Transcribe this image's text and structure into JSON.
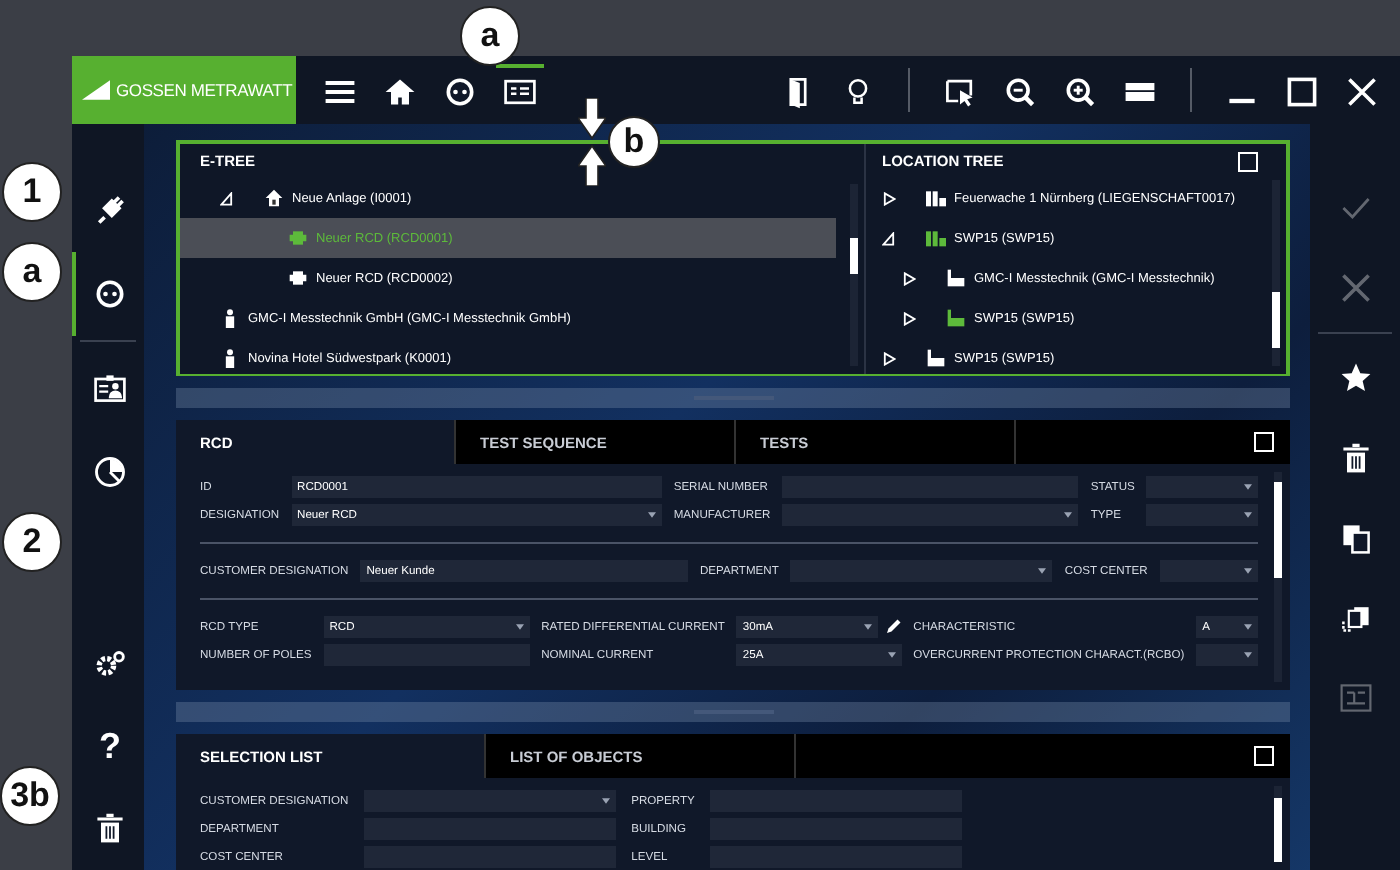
{
  "callouts": [
    {
      "label": "a",
      "kind": "circle"
    },
    {
      "label": "1",
      "kind": "circle"
    },
    {
      "label": "a",
      "kind": "circle"
    },
    {
      "label": "2",
      "kind": "circle"
    },
    {
      "label": "3b",
      "kind": "circle"
    },
    {
      "label": "b",
      "kind": "gap_marker"
    }
  ],
  "logo": {
    "text": "GOSSEN METRAWATT"
  },
  "toolbar_left": [
    {
      "kind": "menu",
      "selected": false
    },
    {
      "kind": "home",
      "selected": false
    },
    {
      "kind": "socket",
      "selected": false
    },
    {
      "kind": "panel",
      "selected": true
    }
  ],
  "toolbar_right": [
    {
      "kind": "door"
    },
    {
      "kind": "bulb"
    },
    {
      "kind": "separator"
    },
    {
      "kind": "select"
    },
    {
      "kind": "zoom-out"
    },
    {
      "kind": "zoom-in"
    },
    {
      "kind": "layout"
    },
    {
      "kind": "separator"
    },
    {
      "kind": "minimize"
    },
    {
      "kind": "maximize"
    },
    {
      "kind": "close"
    }
  ],
  "left_sidebar": {
    "top": [
      {
        "kind": "plug",
        "selected": false
      },
      {
        "kind": "socket",
        "selected": true
      },
      {
        "kind": "id-card",
        "selected": false
      },
      {
        "kind": "pie",
        "selected": false
      }
    ],
    "bottom": [
      {
        "kind": "gear",
        "selected": false
      },
      {
        "kind": "help",
        "glyph": "?",
        "selected": false
      },
      {
        "kind": "trash",
        "selected": false
      }
    ]
  },
  "right_sidebar": [
    {
      "kind": "check",
      "disabled": true
    },
    {
      "kind": "close",
      "disabled": true
    },
    {
      "kind": "star",
      "disabled": false
    },
    {
      "kind": "trash",
      "disabled": false
    },
    {
      "kind": "copy",
      "disabled": false
    },
    {
      "kind": "copy-move",
      "disabled": false
    },
    {
      "kind": "diagram",
      "disabled": true
    }
  ],
  "e_tree": {
    "title": "E-TREE",
    "items": [
      {
        "label": "Neue Anlage (I0001)",
        "kind": "house",
        "expanded": true,
        "selected": false,
        "children": [
          {
            "label": "Neuer RCD (RCD0001)",
            "kind": "rcd",
            "selected": true
          },
          {
            "label": "Neuer RCD (RCD0002)",
            "kind": "rcd",
            "selected": false
          }
        ]
      },
      {
        "label": "GMC-I Messtechnik GmbH (GMC-I Messtechnik GmbH)",
        "kind": "person",
        "selected": false
      },
      {
        "label": "Novina Hotel Südwestpark (K0001)",
        "kind": "person",
        "selected": false
      }
    ]
  },
  "location_tree": {
    "title": "LOCATION TREE",
    "items": [
      {
        "label": "Feuerwache 1 Nürnberg (LIEGENSCHAFT0017)",
        "kind": "property",
        "expanded": false,
        "highlighted": false
      },
      {
        "label": "SWP15 (SWP15)",
        "kind": "property",
        "expanded": true,
        "highlighted": true,
        "children": [
          {
            "label": "GMC-I Messtechnik (GMC-I Messtechnik)",
            "kind": "building",
            "expanded": false,
            "highlighted": false
          },
          {
            "label": "SWP15 (SWP15)",
            "kind": "building",
            "expanded": false,
            "highlighted": true
          }
        ]
      },
      {
        "label": "SWP15 (SWP15)",
        "kind": "building",
        "expanded": false,
        "highlighted": false
      }
    ]
  },
  "detail_panel": {
    "tabs": [
      {
        "label": "RCD",
        "selected": true
      },
      {
        "label": "TEST SEQUENCE",
        "selected": false
      },
      {
        "label": "TESTS",
        "selected": false
      }
    ],
    "sections": [
      [
        {
          "label": "ID",
          "kind": "text",
          "value": "RCD0001"
        },
        {
          "label": "SERIAL NUMBER",
          "kind": "text"
        },
        {
          "label": "STATUS",
          "kind": "dropdown"
        },
        {
          "label": "DESIGNATION",
          "kind": "dropdown",
          "value": "Neuer RCD"
        },
        {
          "label": "MANUFACTURER",
          "kind": "dropdown"
        },
        {
          "label": "TYPE",
          "kind": "dropdown"
        }
      ],
      [
        {
          "label": "CUSTOMER DESIGNATION",
          "kind": "text",
          "value": "Neuer Kunde"
        },
        {
          "label": "DEPARTMENT",
          "kind": "dropdown"
        },
        {
          "label": "COST CENTER",
          "kind": "dropdown"
        }
      ],
      [
        {
          "label": "RCD TYPE",
          "kind": "dropdown",
          "value": "RCD"
        },
        {
          "label": "RATED DIFFERENTIAL CURRENT",
          "kind": "dropdown_edit",
          "value": "30mA"
        },
        {
          "label": "CHARACTERISTIC",
          "kind": "dropdown",
          "value": "A"
        },
        {
          "label": "NUMBER OF POLES",
          "kind": "text"
        },
        {
          "label": "NOMINAL CURRENT",
          "kind": "dropdown",
          "value": "25A"
        },
        {
          "label": "OVERCURRENT PROTECTION CHARACT.(RCBO)",
          "kind": "dropdown"
        }
      ]
    ]
  },
  "selection_panel": {
    "tabs": [
      {
        "label": "SELECTION LIST",
        "selected": true
      },
      {
        "label": "LIST OF OBJECTS",
        "selected": false
      }
    ],
    "fields": [
      {
        "label": "CUSTOMER DESIGNATION",
        "kind": "dropdown"
      },
      {
        "label": "PROPERTY",
        "kind": "text"
      },
      {
        "label": "DEPARTMENT",
        "kind": "text"
      },
      {
        "label": "BUILDING",
        "kind": "text"
      },
      {
        "label": "COST CENTER",
        "kind": "text"
      },
      {
        "label": "LEVEL",
        "kind": "text"
      }
    ]
  }
}
